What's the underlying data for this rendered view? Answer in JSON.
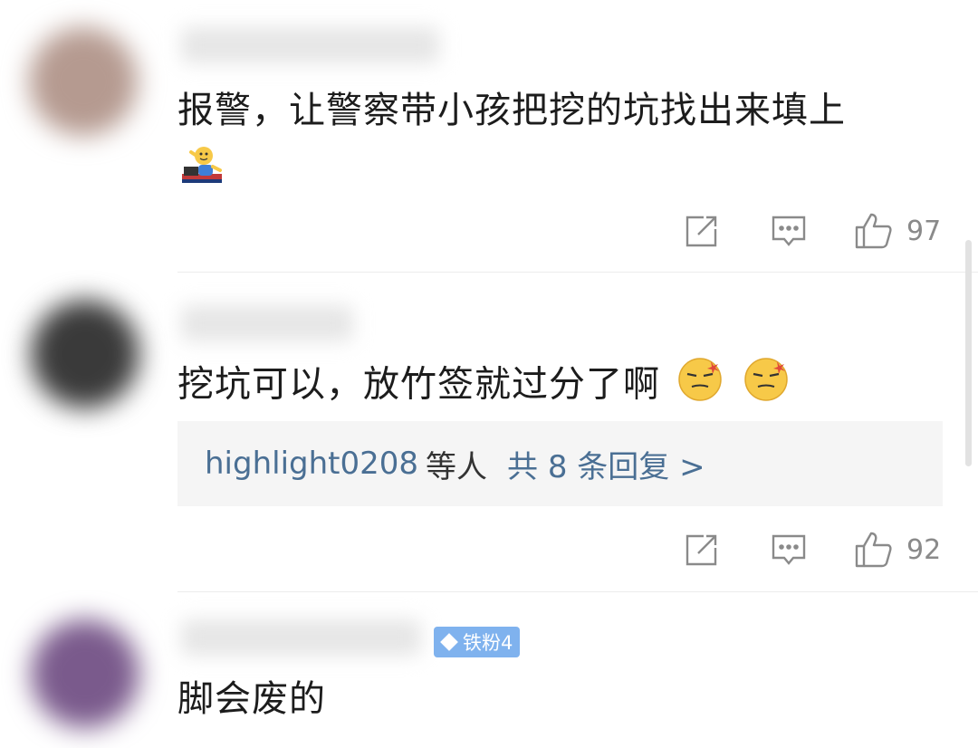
{
  "comments": [
    {
      "text": "报警，让警察带小孩把挖的坑找出来填上",
      "likes": "97",
      "avatar_color": "#b59a90"
    },
    {
      "text": "挖坑可以，放竹签就过分了啊",
      "likes": "92",
      "avatar_color": "#3a3a3a",
      "replies": {
        "user": "highlight0208",
        "middle": "等人",
        "total": "共 8 条回复 >"
      }
    },
    {
      "text": "脚会废的",
      "avatar_color": "#7a5a8c",
      "badge": "铁粉4"
    }
  ],
  "colors": {
    "link": "#4a6f94",
    "badge": "#7fb2ee",
    "icon": "#8a8a8a"
  },
  "icons": [
    "share-icon",
    "comment-icon",
    "thumbs-up-icon"
  ]
}
